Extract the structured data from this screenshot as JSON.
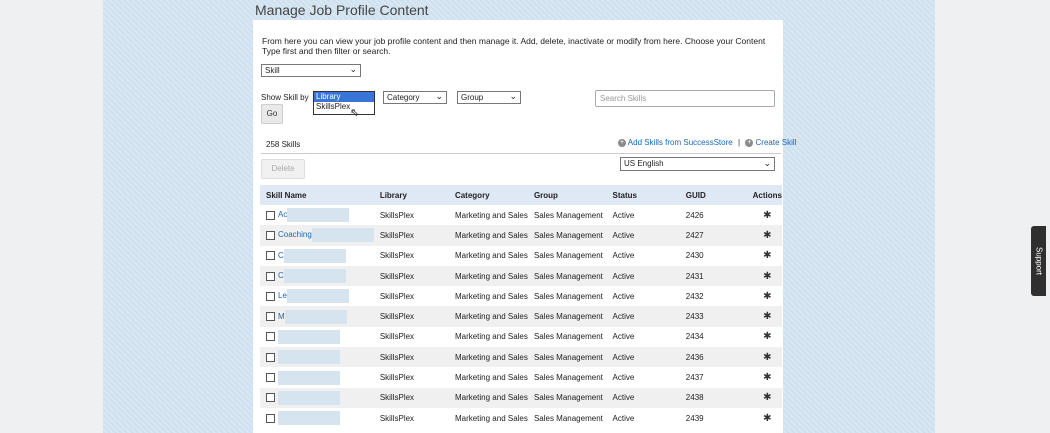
{
  "page": {
    "title": "Manage Job Profile Content"
  },
  "intro": "From here you can view your job profile content and then manage it. Add, delete, inactivate or modify from here. Choose your Content Type first and then filter or search.",
  "content_type": {
    "selected": "Skill"
  },
  "filters": {
    "show_label": "Show Skill by",
    "library_options": [
      "Library",
      "SkillsPlex"
    ],
    "category": "Category",
    "group": "Group",
    "search_placeholder": "Search Skills",
    "go_label": "Go"
  },
  "toolbar": {
    "count": "258 Skills",
    "add_label": "Add Skills from SuccessStore",
    "separator": "|",
    "create_label": "Create Skill",
    "delete_label": "Delete",
    "language": "US English"
  },
  "table": {
    "headers": [
      "Skill Name",
      "Library",
      "Category",
      "Group",
      "Status",
      "GUID",
      "Actions"
    ],
    "rows": [
      {
        "name": "Ac",
        "library": "SkillsPlex",
        "category": "Marketing and Sales",
        "group": "Sales Management",
        "status": "Active",
        "guid": "2426"
      },
      {
        "name": "Coaching",
        "library": "SkillsPlex",
        "category": "Marketing and Sales",
        "group": "Sales Management",
        "status": "Active",
        "guid": "2427"
      },
      {
        "name": "C",
        "library": "SkillsPlex",
        "category": "Marketing and Sales",
        "group": "Sales Management",
        "status": "Active",
        "guid": "2430"
      },
      {
        "name": "C",
        "library": "SkillsPlex",
        "category": "Marketing and Sales",
        "group": "Sales Management",
        "status": "Active",
        "guid": "2431"
      },
      {
        "name": "Le",
        "library": "SkillsPlex",
        "category": "Marketing and Sales",
        "group": "Sales Management",
        "status": "Active",
        "guid": "2432"
      },
      {
        "name": "M",
        "library": "SkillsPlex",
        "category": "Marketing and Sales",
        "group": "Sales Management",
        "status": "Active",
        "guid": "2433"
      },
      {
        "name": "",
        "library": "SkillsPlex",
        "category": "Marketing and Sales",
        "group": "Sales Management",
        "status": "Active",
        "guid": "2434"
      },
      {
        "name": "",
        "library": "SkillsPlex",
        "category": "Marketing and Sales",
        "group": "Sales Management",
        "status": "Active",
        "guid": "2436"
      },
      {
        "name": "",
        "library": "SkillsPlex",
        "category": "Marketing and Sales",
        "group": "Sales Management",
        "status": "Active",
        "guid": "2437"
      },
      {
        "name": "",
        "library": "SkillsPlex",
        "category": "Marketing and Sales",
        "group": "Sales Management",
        "status": "Active",
        "guid": "2438"
      },
      {
        "name": "",
        "library": "SkillsPlex",
        "category": "Marketing and Sales",
        "group": "Sales Management",
        "status": "Active",
        "guid": "2439"
      }
    ]
  },
  "support": {
    "label": "Support"
  },
  "icons": {
    "gear": "gear-icon",
    "add": "plus-circle-icon",
    "chevron": "chevron-down-icon"
  },
  "colors": {
    "link": "#1a66b8",
    "header_bg": "#dfe9f5",
    "selected_option": "#3875d7"
  }
}
